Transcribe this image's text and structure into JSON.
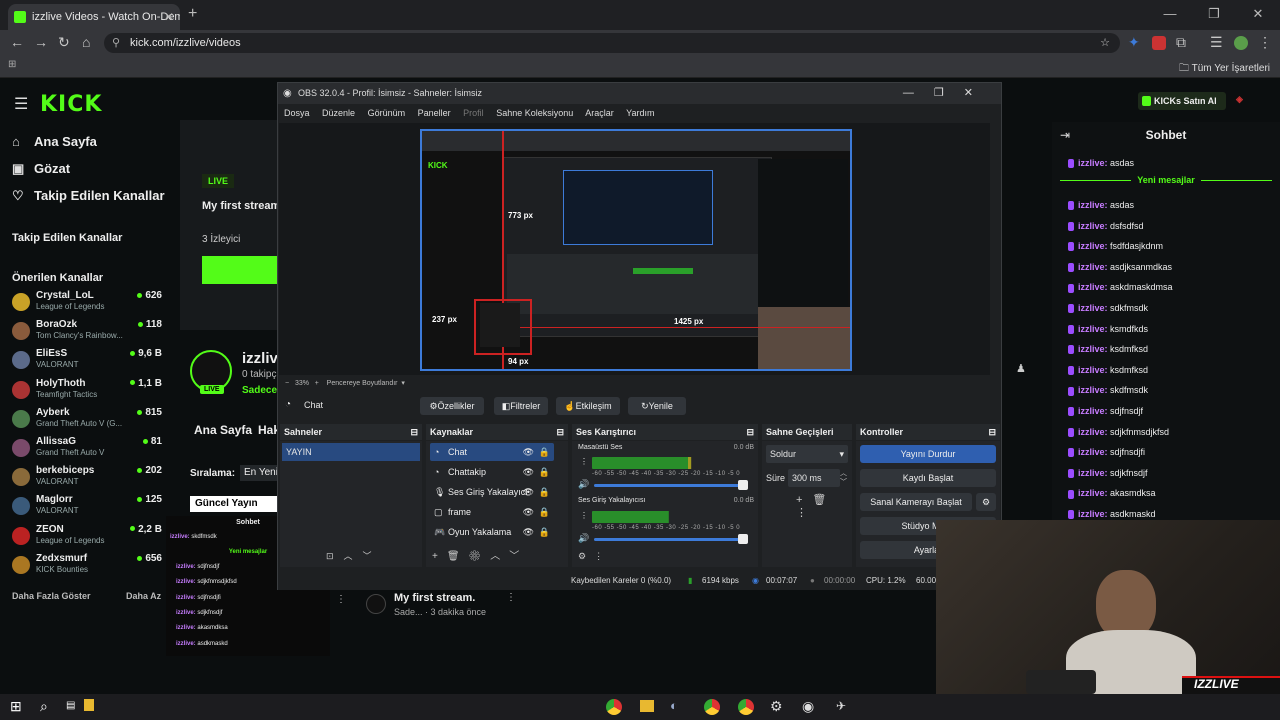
{
  "browser": {
    "tab_title": "izzlive Videos - Watch On-Dem",
    "url": "kick.com/izzlive/videos",
    "bookmarks_label": "Tüm Yer İşaretleri"
  },
  "kick": {
    "logo": "KICK",
    "nav": [
      "Ana Sayfa",
      "Gözat",
      "Takip Edilen Kanallar"
    ],
    "following_heading": "Takip Edilen Kanallar",
    "recommended_heading": "Önerilen Kanallar",
    "channels": [
      {
        "name": "Crystal_LoL",
        "game": "League of Legends",
        "viewers": "626",
        "color": "#c9a227"
      },
      {
        "name": "BoraOzk",
        "game": "Tom Clancy's Rainbow...",
        "viewers": "118",
        "color": "#8a5b3c"
      },
      {
        "name": "EliEsS",
        "game": "VALORANT",
        "viewers": "9,6 B",
        "color": "#5b6a8a"
      },
      {
        "name": "HolyThoth",
        "game": "Teamfight Tactics",
        "viewers": "1,1 B",
        "color": "#a33"
      },
      {
        "name": "Ayberk",
        "game": "Grand Theft Auto V (G...",
        "viewers": "815",
        "color": "#4a7a4a"
      },
      {
        "name": "AllissaG",
        "game": "Grand Theft Auto V",
        "viewers": "81",
        "color": "#7a4a6a"
      },
      {
        "name": "berkebiceps",
        "game": "VALORANT",
        "viewers": "202",
        "color": "#8a6a3a"
      },
      {
        "name": "Maglorr",
        "game": "VALORANT",
        "viewers": "125",
        "color": "#3a5a7a"
      },
      {
        "name": "ZEON",
        "game": "League of Legends",
        "viewers": "2,2 B",
        "color": "#b22"
      },
      {
        "name": "Zedxsmurf",
        "game": "KICK Bounties",
        "viewers": "656",
        "color": "#aa7722"
      }
    ],
    "show_more": "Daha Fazla Göster",
    "show_less": "Daha Az",
    "live_badge": "LIVE",
    "stream_title": "My first stream",
    "viewers_text": "3 İzleyici",
    "channel_name": "izzliv",
    "followers": "0 takipç",
    "only_text": "Sadece",
    "tabs": [
      "Ana Sayfa",
      "Hak"
    ],
    "sort_label": "Sıralama:",
    "sort_value": "En Yeni",
    "current_stream_btn": "Güncel Yayın",
    "video_title": "My first stream.",
    "video_meta": "Sade... · 3 dakika önce",
    "kicks_button": "KICKs Satın Al"
  },
  "chat": {
    "title": "Sohbet",
    "new_messages": "Yeni mesajlar",
    "first": {
      "user": "izzlive:",
      "text": "asdas"
    },
    "messages": [
      {
        "user": "izzlive:",
        "text": "asdas"
      },
      {
        "user": "izzlive:",
        "text": "dsfsdfsd"
      },
      {
        "user": "izzlive:",
        "text": "fsdfdasjkdnm"
      },
      {
        "user": "izzlive:",
        "text": "asdjksanmdkas"
      },
      {
        "user": "izzlive:",
        "text": "askdmaskdmsa"
      },
      {
        "user": "izzlive:",
        "text": "sdkfmsdk"
      },
      {
        "user": "izzlive:",
        "text": "ksmdfkds"
      },
      {
        "user": "izzlive:",
        "text": "ksdmfksd"
      },
      {
        "user": "izzlive:",
        "text": "ksdmfksd"
      },
      {
        "user": "izzlive:",
        "text": "skdfmsdk"
      },
      {
        "user": "izzlive:",
        "text": "sdjfnsdjf"
      },
      {
        "user": "izzlive:",
        "text": "sdjkfnmsdjkfsd"
      },
      {
        "user": "izzlive:",
        "text": "sdjfnsdjfi"
      },
      {
        "user": "izzlive:",
        "text": "sdjkfnsdjf"
      },
      {
        "user": "izzlive:",
        "text": "akasmdksa"
      },
      {
        "user": "izzlive:",
        "text": "asdkmaskd"
      }
    ]
  },
  "mini_chat": {
    "title": "Sohbet",
    "new_messages": "Yeni mesajlar",
    "first": "skdfmsdk",
    "messages": [
      "sdjfnsdjf",
      "sdjkfnmsdjkfsd",
      "sdjfnsdjfi",
      "sdjkfnsdjf",
      "akasmdksa",
      "asdkmaskd"
    ],
    "user": "izzlive:"
  },
  "obs": {
    "title": "OBS 32.0.4 - Profil: İsimsiz - Sahneler: İsimsiz",
    "menu": [
      "Dosya",
      "Düzenle",
      "Görünüm",
      "Paneller",
      "Profil",
      "Sahne Koleksiyonu",
      "Araçlar",
      "Yardım"
    ],
    "zoom": "33%",
    "fit_label": "Pencereye Boyutlandır",
    "preview_measures": [
      "773 px",
      "237 px",
      "1425 px",
      "94 px"
    ],
    "source_selected": "Chat",
    "source_buttons": [
      "Özellikler",
      "Filtreler",
      "Etkileşim",
      "Yenile"
    ],
    "scenes_title": "Sahneler",
    "scenes": [
      "YAYIN"
    ],
    "sources_title": "Kaynaklar",
    "sources": [
      "Chat",
      "Chattakip",
      "Ses Giriş Yakalayıcı",
      "frame",
      "Oyun Yakalama"
    ],
    "mixer_title": "Ses Karıştırıcı",
    "mixer": [
      {
        "name": "Masaüstü Ses",
        "db": "0.0 dB",
        "level": 0.62
      },
      {
        "name": "Ses Giriş Yakalayıcısı",
        "db": "0.0 dB",
        "level": 0.48
      }
    ],
    "mixer_scale": "-60 -55 -50 -45 -40 -35 -30 -25 -20 -15 -10 -5 0",
    "transitions_title": "Sahne Geçişleri",
    "transition_value": "Soldur",
    "duration_label": "Süre",
    "duration_value": "300 ms",
    "controls_title": "Kontroller",
    "controls": [
      "Yayını Durdur",
      "Kaydı Başlat",
      "Sanal Kamerayı Başlat",
      "Stüdyo Modu",
      "Ayarlar"
    ],
    "status": {
      "dropped": "Kaybedilen Kareler 0 (%0.0)",
      "bitrate": "6194 kbps",
      "stream_time": "00:07:07",
      "rec_time": "00:00:00",
      "cpu": "CPU: 1.2%",
      "fps": "60.00"
    }
  },
  "webcam_overlay": "IZZLIVE"
}
